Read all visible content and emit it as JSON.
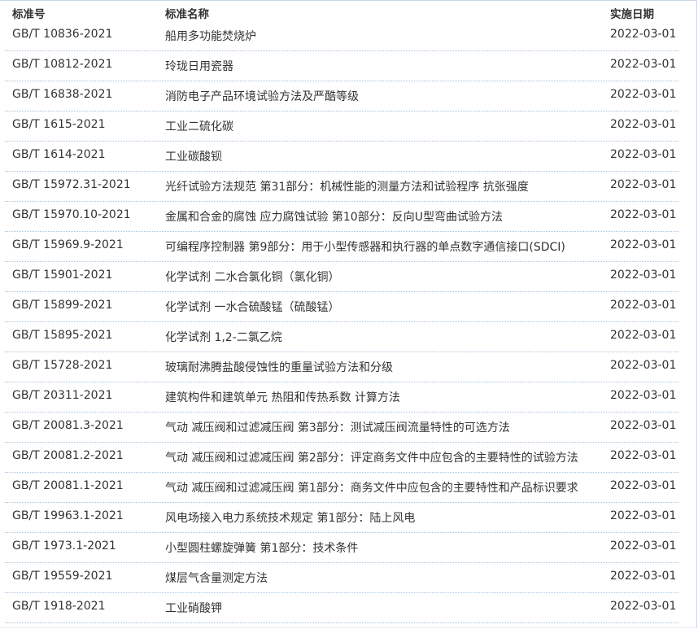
{
  "table": {
    "headers": {
      "code": "标准号",
      "name": "标准名称",
      "date": "实施日期"
    },
    "rows": [
      {
        "code": "GB/T 10836-2021",
        "name": "船用多功能焚烧炉",
        "date": "2022-03-01"
      },
      {
        "code": "GB/T 10812-2021",
        "name": "玲珑日用瓷器",
        "date": "2022-03-01"
      },
      {
        "code": "GB/T 16838-2021",
        "name": "消防电子产品环境试验方法及严酷等级",
        "date": "2022-03-01"
      },
      {
        "code": "GB/T 1615-2021",
        "name": "工业二硫化碳",
        "date": "2022-03-01"
      },
      {
        "code": "GB/T 1614-2021",
        "name": "工业碳酸钡",
        "date": "2022-03-01"
      },
      {
        "code": "GB/T 15972.31-2021",
        "name": "光纤试验方法规范 第31部分：机械性能的测量方法和试验程序 抗张强度",
        "date": "2022-03-01"
      },
      {
        "code": "GB/T 15970.10-2021",
        "name": "金属和合金的腐蚀 应力腐蚀试验 第10部分：反向U型弯曲试验方法",
        "date": "2022-03-01"
      },
      {
        "code": "GB/T 15969.9-2021",
        "name": "可编程序控制器 第9部分：用于小型传感器和执行器的单点数字通信接口(SDCI)",
        "date": "2022-03-01"
      },
      {
        "code": "GB/T 15901-2021",
        "name": "化学试剂 二水合氯化铜（氯化铜）",
        "date": "2022-03-01"
      },
      {
        "code": "GB/T 15899-2021",
        "name": "化学试剂 一水合硫酸锰（硫酸锰）",
        "date": "2022-03-01"
      },
      {
        "code": "GB/T 15895-2021",
        "name": "化学试剂 1,2-二氯乙烷",
        "date": "2022-03-01"
      },
      {
        "code": "GB/T 15728-2021",
        "name": "玻璃耐沸腾盐酸侵蚀性的重量试验方法和分级",
        "date": "2022-03-01"
      },
      {
        "code": "GB/T 20311-2021",
        "name": "建筑构件和建筑单元 热阻和传热系数 计算方法",
        "date": "2022-03-01"
      },
      {
        "code": "GB/T 20081.3-2021",
        "name": "气动 减压阀和过滤减压阀 第3部分：测试减压阀流量特性的可选方法",
        "date": "2022-03-01"
      },
      {
        "code": "GB/T 20081.2-2021",
        "name": "气动 减压阀和过滤减压阀 第2部分：评定商务文件中应包含的主要特性的试验方法",
        "date": "2022-03-01"
      },
      {
        "code": "GB/T 20081.1-2021",
        "name": "气动 减压阀和过滤减压阀 第1部分：商务文件中应包含的主要特性和产品标识要求",
        "date": "2022-03-01"
      },
      {
        "code": "GB/T 19963.1-2021",
        "name": "风电场接入电力系统技术规定 第1部分：陆上风电",
        "date": "2022-03-01"
      },
      {
        "code": "GB/T 1973.1-2021",
        "name": "小型圆柱螺旋弹簧 第1部分：技术条件",
        "date": "2022-03-01"
      },
      {
        "code": "GB/T 19559-2021",
        "name": "煤层气含量测定方法",
        "date": "2022-03-01"
      },
      {
        "code": "GB/T 1918-2021",
        "name": "工业硝酸钾",
        "date": "2022-03-01"
      }
    ]
  }
}
